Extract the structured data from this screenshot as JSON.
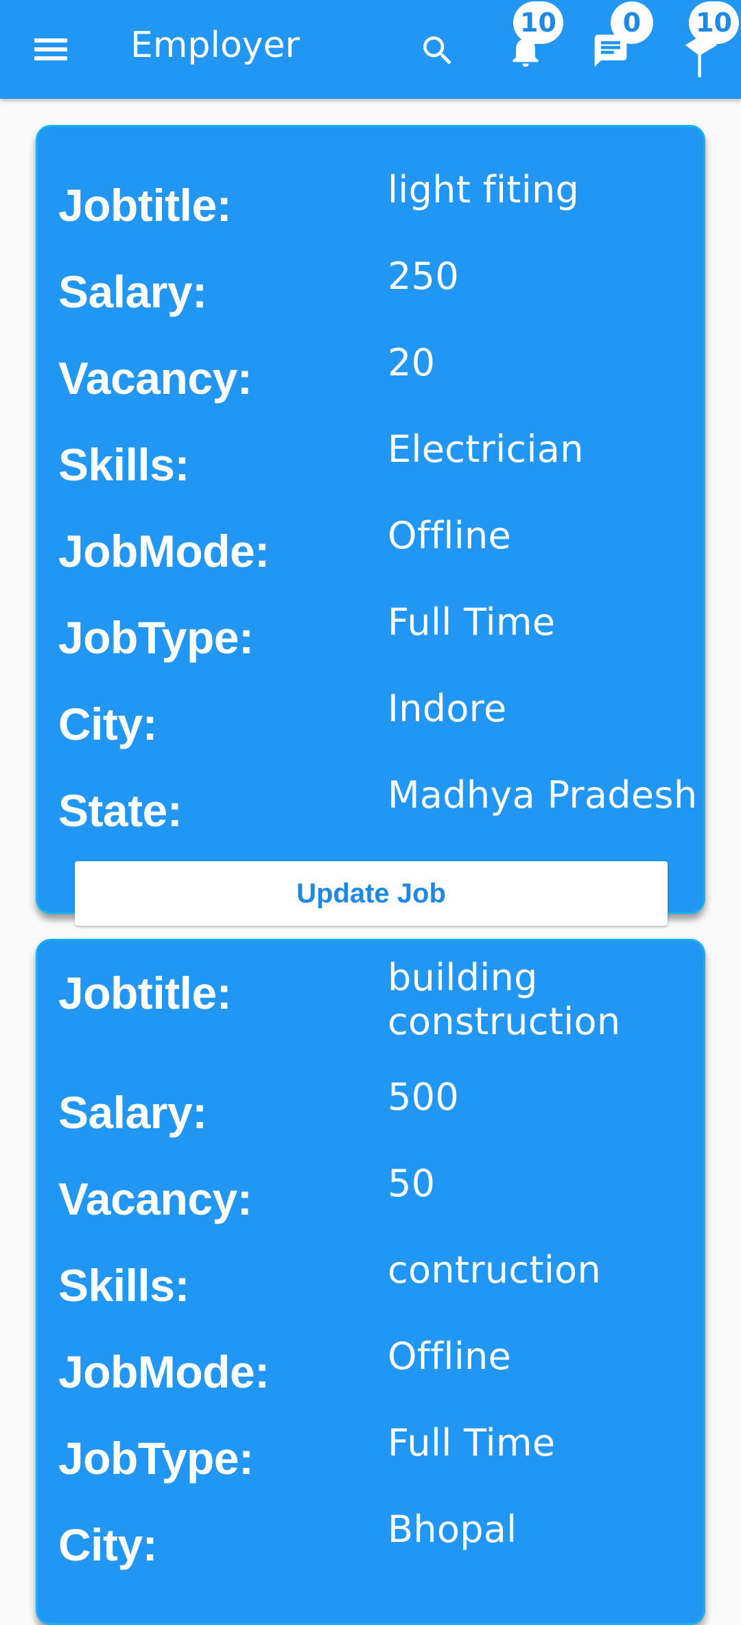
{
  "appbar": {
    "title": "Employer",
    "notifications_count": "10",
    "messages_count": "0",
    "third_count": "10"
  },
  "jobs": [
    {
      "fields": [
        {
          "label": "Jobtitle:",
          "value": "light fiting"
        },
        {
          "label": "Salary:",
          "value": "250"
        },
        {
          "label": "Vacancy:",
          "value": "20"
        },
        {
          "label": "Skills:",
          "value": "Electrician"
        },
        {
          "label": "JobMode:",
          "value": "Offline"
        },
        {
          "label": "JobType:",
          "value": "Full Time"
        },
        {
          "label": "City:",
          "value": "Indore"
        },
        {
          "label": "State:",
          "value": "Madhya Pradesh"
        }
      ],
      "button_label": "Update Job"
    },
    {
      "fields": [
        {
          "label": "Jobtitle:",
          "value": "building construction"
        },
        {
          "label": "Salary:",
          "value": "500"
        },
        {
          "label": "Vacancy:",
          "value": "50"
        },
        {
          "label": "Skills:",
          "value": "contruction"
        },
        {
          "label": "JobMode:",
          "value": "Offline"
        },
        {
          "label": "JobType:",
          "value": "Full Time"
        },
        {
          "label": "City:",
          "value": "Bhopal"
        }
      ]
    }
  ]
}
